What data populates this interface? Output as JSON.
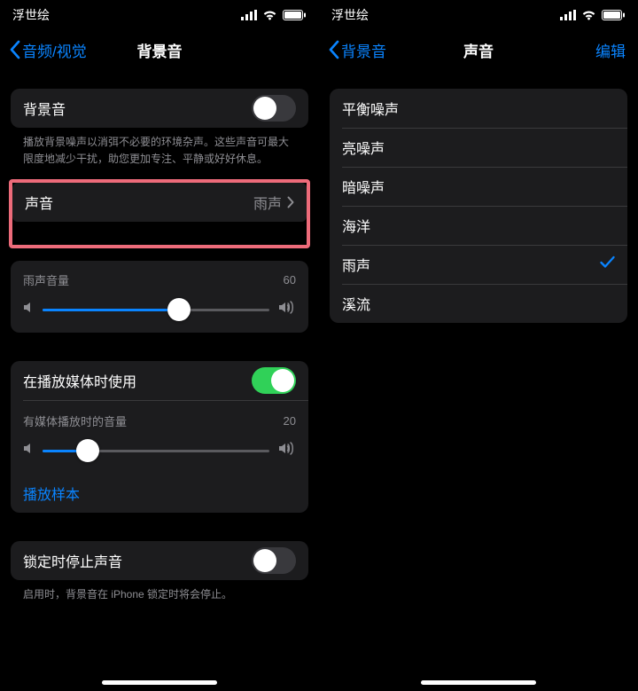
{
  "colors": {
    "accent": "#0a84ff",
    "switchOn": "#30d158",
    "highlight": "#ed6b7a"
  },
  "left": {
    "status": {
      "title": "浮世绘"
    },
    "nav": {
      "back": "音频/视觉",
      "title": "背景音"
    },
    "bgSoundRow": {
      "label": "背景音"
    },
    "bgSoundHelp": "播放背景噪声以消弭不必要的环境杂声。这些声音可最大限度地减少干扰，助您更加专注、平静或好好休息。",
    "soundRow": {
      "label": "声音",
      "value": "雨声"
    },
    "volume1": {
      "label": "雨声音量",
      "value": "60",
      "percent": 60
    },
    "mediaRow": {
      "label": "在播放媒体时使用"
    },
    "volume2": {
      "label": "有媒体播放时的音量",
      "value": "20",
      "percent": 20
    },
    "playSample": "播放样本",
    "lockRow": {
      "label": "锁定时停止声音"
    },
    "lockHelp": "启用时，背景音在 iPhone 锁定时将会停止。"
  },
  "right": {
    "status": {
      "title": "浮世绘"
    },
    "nav": {
      "back": "背景音",
      "title": "声音",
      "edit": "编辑"
    },
    "options": [
      {
        "label": "平衡噪声",
        "selected": false
      },
      {
        "label": "亮噪声",
        "selected": false
      },
      {
        "label": "暗噪声",
        "selected": false
      },
      {
        "label": "海洋",
        "selected": false
      },
      {
        "label": "雨声",
        "selected": true
      },
      {
        "label": "溪流",
        "selected": false
      }
    ]
  }
}
